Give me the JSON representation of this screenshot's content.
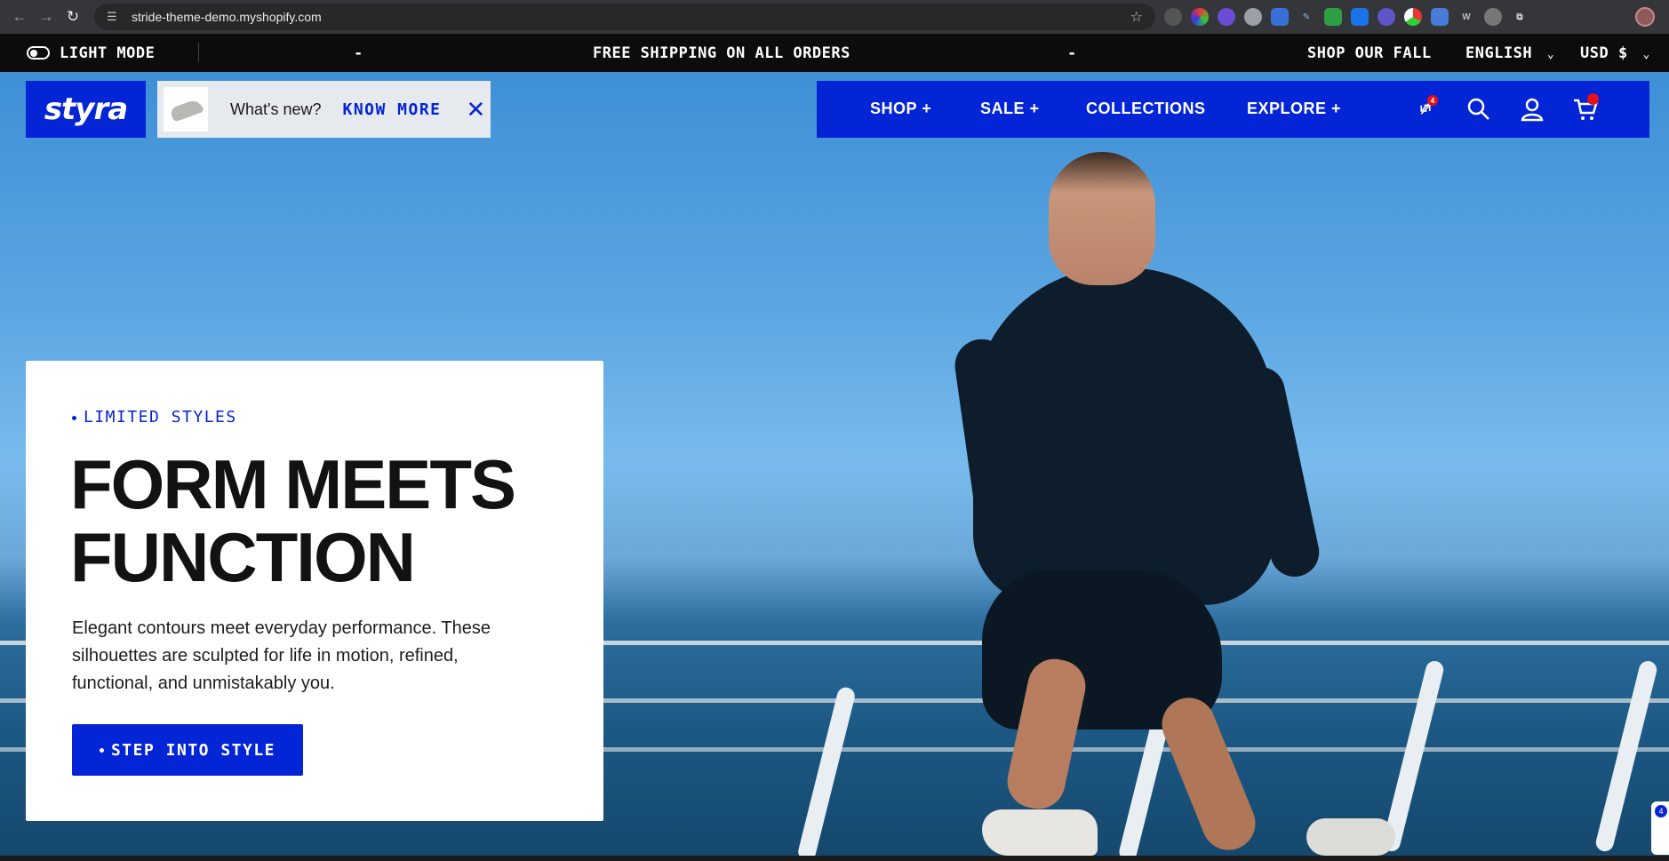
{
  "browser": {
    "url": "stride-theme-demo.myshopify.com"
  },
  "announcement": {
    "mode_label": "LIGHT MODE",
    "dash_left": "-",
    "message": "FREE SHIPPING ON ALL ORDERS",
    "dash_right": "-",
    "promo": "SHOP OUR FALL",
    "language": "ENGLISH",
    "currency": "USD $"
  },
  "header": {
    "logo_text": "styra",
    "whats_new": {
      "label": "What's new?",
      "link": "KNOW MORE"
    },
    "nav": [
      {
        "label": "SHOP +"
      },
      {
        "label": "SALE +"
      },
      {
        "label": "COLLECTIONS"
      },
      {
        "label": "EXPLORE +"
      }
    ],
    "compare_count": "4",
    "icons": [
      "compare-icon",
      "search-icon",
      "account-icon",
      "cart-icon"
    ]
  },
  "hero": {
    "eyebrow": "LIMITED STYLES",
    "headline_line1": "FORM MEETS",
    "headline_line2": "FUNCTION",
    "body": "Elegant contours meet everyday performance. These silhouettes are sculpted for life in motion, refined, functional, and unmistakably you.",
    "cta": "STEP INTO STYLE"
  },
  "widget": {
    "count": "4"
  },
  "colors": {
    "brand_blue": "#0425d6",
    "badge_red": "#e5101a",
    "announce_bg": "#0c0c0c"
  }
}
